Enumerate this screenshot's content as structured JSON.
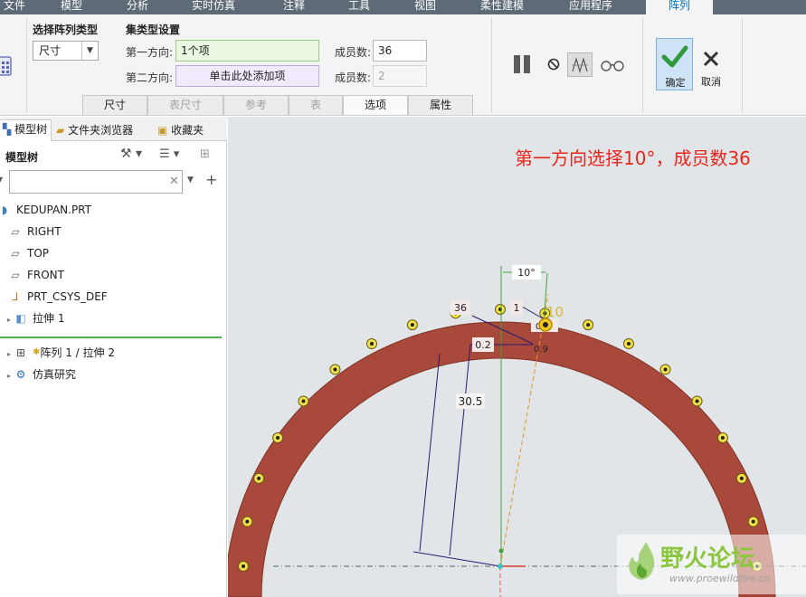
{
  "menu": {
    "tabs": [
      "文件",
      "模型",
      "分析",
      "实时仿真",
      "注释",
      "工具",
      "视图",
      "柔性建模",
      "应用程序",
      "阵列"
    ],
    "active": "阵列"
  },
  "ribbon": {
    "pattern_type": {
      "title": "选择阵列类型",
      "value": "尺寸"
    },
    "collection": {
      "title": "集类型设置",
      "dir1_label": "第一方向:",
      "dir1_value": "1个项",
      "dir2_label": "第二方向:",
      "dir2_value": "单击此处添加项",
      "members1_label": "成员数:",
      "members1_value": "36",
      "members2_label": "成员数:",
      "members2_value": "2"
    },
    "subtabs": [
      "尺寸",
      "表尺寸",
      "参考",
      "表",
      "选项",
      "属性"
    ],
    "ok_label": "确定",
    "cancel_label": "取消"
  },
  "panel": {
    "tabs": [
      "模型树",
      "文件夹浏览器",
      "收藏夹"
    ],
    "tree_title": "模型树",
    "search": {
      "value": "",
      "placeholder": ""
    },
    "items": [
      {
        "label": "KEDUPAN.PRT",
        "icon": "part-icon"
      },
      {
        "label": "RIGHT",
        "icon": "datum-plane-icon"
      },
      {
        "label": "TOP",
        "icon": "datum-plane-icon"
      },
      {
        "label": "FRONT",
        "icon": "datum-plane-icon"
      },
      {
        "label": "PRT_CSYS_DEF",
        "icon": "csys-icon"
      },
      {
        "label": "拉伸 1",
        "icon": "extrude-icon"
      },
      {
        "label": "阵列 1 / 拉伸 2",
        "icon": "pattern-icon"
      },
      {
        "label": "仿真研究",
        "icon": "simulation-icon"
      }
    ]
  },
  "canvas": {
    "annotation": "第一方向选择10°，成员数36",
    "dims": {
      "angle": "10°",
      "increment": "10",
      "count": "36",
      "d1": "1",
      "d2": "0.2",
      "d3": "30.5",
      "d4": "0",
      "d5": "0.9"
    },
    "colors": {
      "ring": "#a8493b",
      "hole": "#f0e04a",
      "annotation": "#e8261c",
      "accent_green": "#3fa535"
    },
    "watermark": {
      "title": "野火论坛",
      "url": "www.proewildfire.cn"
    }
  }
}
